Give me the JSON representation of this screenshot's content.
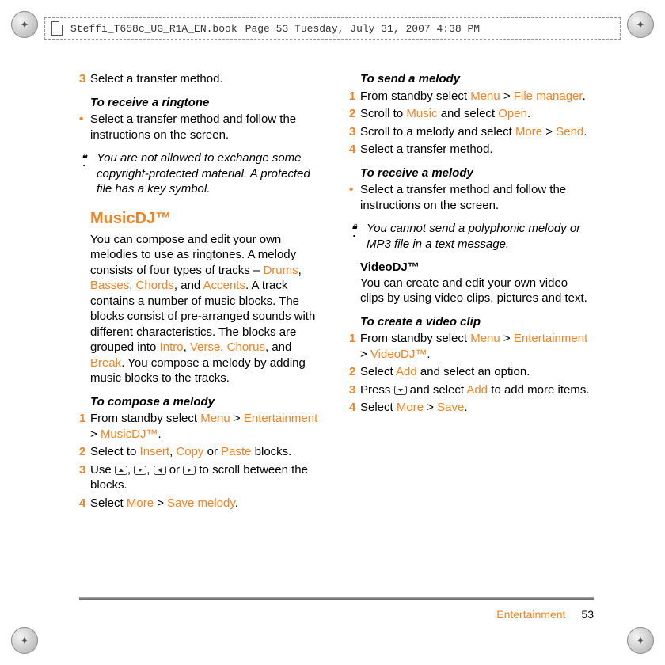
{
  "header": {
    "filename": "Steffi_T658c_UG_R1A_EN.book",
    "pageinfo": "Page 53  Tuesday, July 31, 2007  4:38 PM"
  },
  "left": {
    "step3": "Select a transfer method.",
    "h_receive_ringtone": "To receive a ringtone",
    "bullet1": "Select a transfer method and follow the instructions on the screen.",
    "note1": "You are not allowed to exchange some copyright-protected material. A protected file has a key symbol.",
    "section_musicdj": "MusicDJ™",
    "musicdj_body_a": "You can compose and edit your own melodies to use as ringtones. A melody consists of four types of tracks – ",
    "musicdj_tracks": {
      "drums": "Drums",
      "basses": "Basses",
      "chords": "Chords",
      "accents": "Accents"
    },
    "musicdj_body_b": ". A track contains a number of music blocks. The blocks consist of pre-arranged sounds with different characteristics. The blocks are grouped into ",
    "musicdj_groups": {
      "intro": "Intro",
      "verse": "Verse",
      "chorus": "Chorus",
      "break": "Break"
    },
    "musicdj_body_c": ". You compose a melody by adding music blocks to the tracks.",
    "h_compose": "To compose a melody",
    "compose_s1_a": "From standby select ",
    "compose_s1_menu": "Menu",
    "compose_s1_gt1": " > ",
    "compose_s1_ent": "Entertainment",
    "compose_s1_gt2": " > ",
    "compose_s1_mdj": "MusicDJ™",
    "compose_s1_end": ".",
    "compose_s2_a": "Select to ",
    "compose_s2_insert": "Insert",
    "compose_s2_b": ", ",
    "compose_s2_copy": "Copy",
    "compose_s2_c": " or ",
    "compose_s2_paste": "Paste",
    "compose_s2_d": " blocks.",
    "compose_s3_a": "Use ",
    "compose_s3_b": ", ",
    "compose_s3_c": ", ",
    "compose_s3_d": " or ",
    "compose_s3_e": " to scroll between the blocks.",
    "compose_s4_a": "Select ",
    "compose_s4_more": "More",
    "compose_s4_gt": " > ",
    "compose_s4_save": "Save melody",
    "compose_s4_end": "."
  },
  "right": {
    "h_send_melody": "To send a melody",
    "send_s1_a": "From standby select ",
    "send_s1_menu": "Menu",
    "send_s1_gt": " > ",
    "send_s1_fm": "File manager",
    "send_s1_end": ".",
    "send_s2_a": "Scroll to ",
    "send_s2_music": "Music",
    "send_s2_b": " and select ",
    "send_s2_open": "Open",
    "send_s2_end": ".",
    "send_s3_a": "Scroll to a melody and select ",
    "send_s3_more": "More",
    "send_s3_gt": " > ",
    "send_s3_send": "Send",
    "send_s3_end": ".",
    "send_s4": "Select a transfer method.",
    "h_receive_melody": "To receive a melody",
    "recv_bullet": "Select a transfer method and follow the instructions on the screen.",
    "note2": "You cannot send a polyphonic melody or MP3 file in a text message.",
    "videodj_title": "VideoDJ™",
    "videodj_body": "You can create and edit your own video clips by using video clips, pictures and text.",
    "h_create_clip": "To create a video clip",
    "clip_s1_a": "From standby select ",
    "clip_s1_menu": "Menu",
    "clip_s1_gt1": " > ",
    "clip_s1_ent": "Entertainment",
    "clip_s1_gt2": " > ",
    "clip_s1_vdj": "VideoDJ™",
    "clip_s1_end": ".",
    "clip_s2_a": "Select ",
    "clip_s2_add": "Add",
    "clip_s2_b": " and select an option.",
    "clip_s3_a": "Press ",
    "clip_s3_b": " and select ",
    "clip_s3_add": "Add",
    "clip_s3_c": " to add more items.",
    "clip_s4_a": "Select ",
    "clip_s4_more": "More",
    "clip_s4_gt": " > ",
    "clip_s4_save": "Save",
    "clip_s4_end": "."
  },
  "footer": {
    "section": "Entertainment",
    "page": "53"
  }
}
